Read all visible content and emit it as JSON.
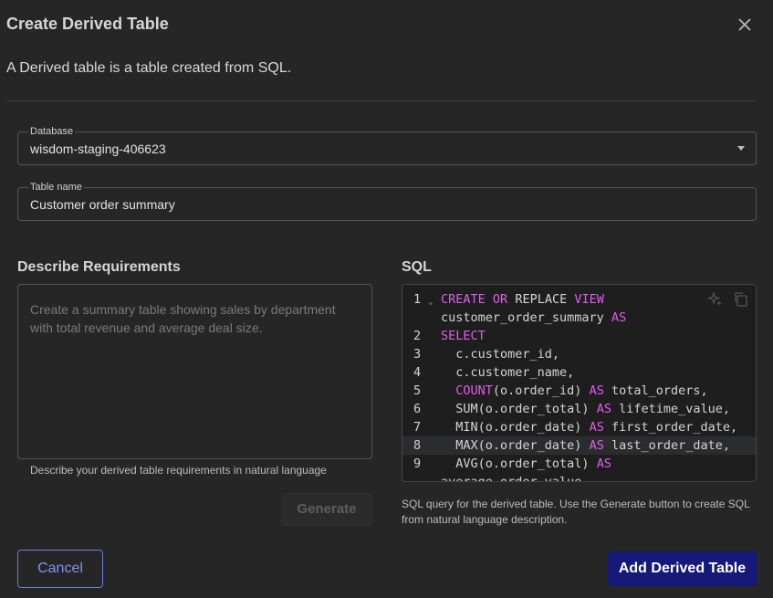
{
  "dialog": {
    "title": "Create Derived Table",
    "subtitle": "A Derived table is a table created from SQL."
  },
  "database": {
    "label": "Database",
    "value": "wisdom-staging-406623"
  },
  "table_name": {
    "label": "Table name",
    "value": "Customer order summary"
  },
  "requirements": {
    "title": "Describe Requirements",
    "placeholder_line1": "Create a summary table showing sales by department",
    "placeholder_line2": "with total revenue and average deal size.",
    "helper": "Describe your derived table requirements in natural language",
    "generate_label": "Generate"
  },
  "sql": {
    "title": "SQL",
    "helper_line1": "SQL query for the derived table. Use the Generate button to create SQL",
    "helper_line2": "from natural language description.",
    "lines": [
      {
        "num": "1",
        "tokens": [
          {
            "t": "CREATE",
            "k": true
          },
          {
            "t": " ",
            "k": false
          },
          {
            "t": "OR",
            "k": true
          },
          {
            "t": " REPLACE ",
            "k": false
          },
          {
            "t": "VIEW",
            "k": true
          }
        ]
      },
      {
        "num": "",
        "tokens": [
          {
            "t": "customer_order_summary ",
            "k": false
          },
          {
            "t": "AS",
            "k": true
          }
        ]
      },
      {
        "num": "2",
        "tokens": [
          {
            "t": "SELECT",
            "k": true
          }
        ]
      },
      {
        "num": "3",
        "tokens": [
          {
            "t": "  c.customer_id,",
            "k": false
          }
        ]
      },
      {
        "num": "4",
        "tokens": [
          {
            "t": "  c.customer_name,",
            "k": false
          }
        ]
      },
      {
        "num": "5",
        "tokens": [
          {
            "t": "  ",
            "k": false
          },
          {
            "t": "COUNT",
            "k": true
          },
          {
            "t": "(o.order_id) ",
            "k": false
          },
          {
            "t": "AS",
            "k": true
          },
          {
            "t": " total_orders,",
            "k": false
          }
        ]
      },
      {
        "num": "6",
        "tokens": [
          {
            "t": "  SUM(o.order_total) ",
            "k": false
          },
          {
            "t": "AS",
            "k": true
          },
          {
            "t": " lifetime_value,",
            "k": false
          }
        ]
      },
      {
        "num": "7",
        "tokens": [
          {
            "t": "  MIN(o.order_date) ",
            "k": false
          },
          {
            "t": "AS",
            "k": true
          },
          {
            "t": " first_order_date,",
            "k": false
          }
        ]
      },
      {
        "num": "8",
        "tokens": [
          {
            "t": "  MAX(o.order_date) ",
            "k": false
          },
          {
            "t": "AS",
            "k": true
          },
          {
            "t": " last_order_date,",
            "k": false
          }
        ]
      },
      {
        "num": "9",
        "tokens": [
          {
            "t": "  AVG(o.order_total) ",
            "k": false
          },
          {
            "t": "AS",
            "k": true
          }
        ]
      },
      {
        "num": "",
        "tokens": [
          {
            "t": "average_order_value",
            "k": false
          }
        ]
      }
    ],
    "active_line_index": 8
  },
  "footer": {
    "cancel_label": "Cancel",
    "submit_label": "Add Derived Table"
  },
  "colors": {
    "accent": "#15197a",
    "keyword": "#e05cf0"
  },
  "icons": {
    "close": "close-icon",
    "dropdown": "chevron-down-icon",
    "ai": "sparkle-icon",
    "copy": "copy-icon",
    "fold": "fold-chevron-icon"
  }
}
